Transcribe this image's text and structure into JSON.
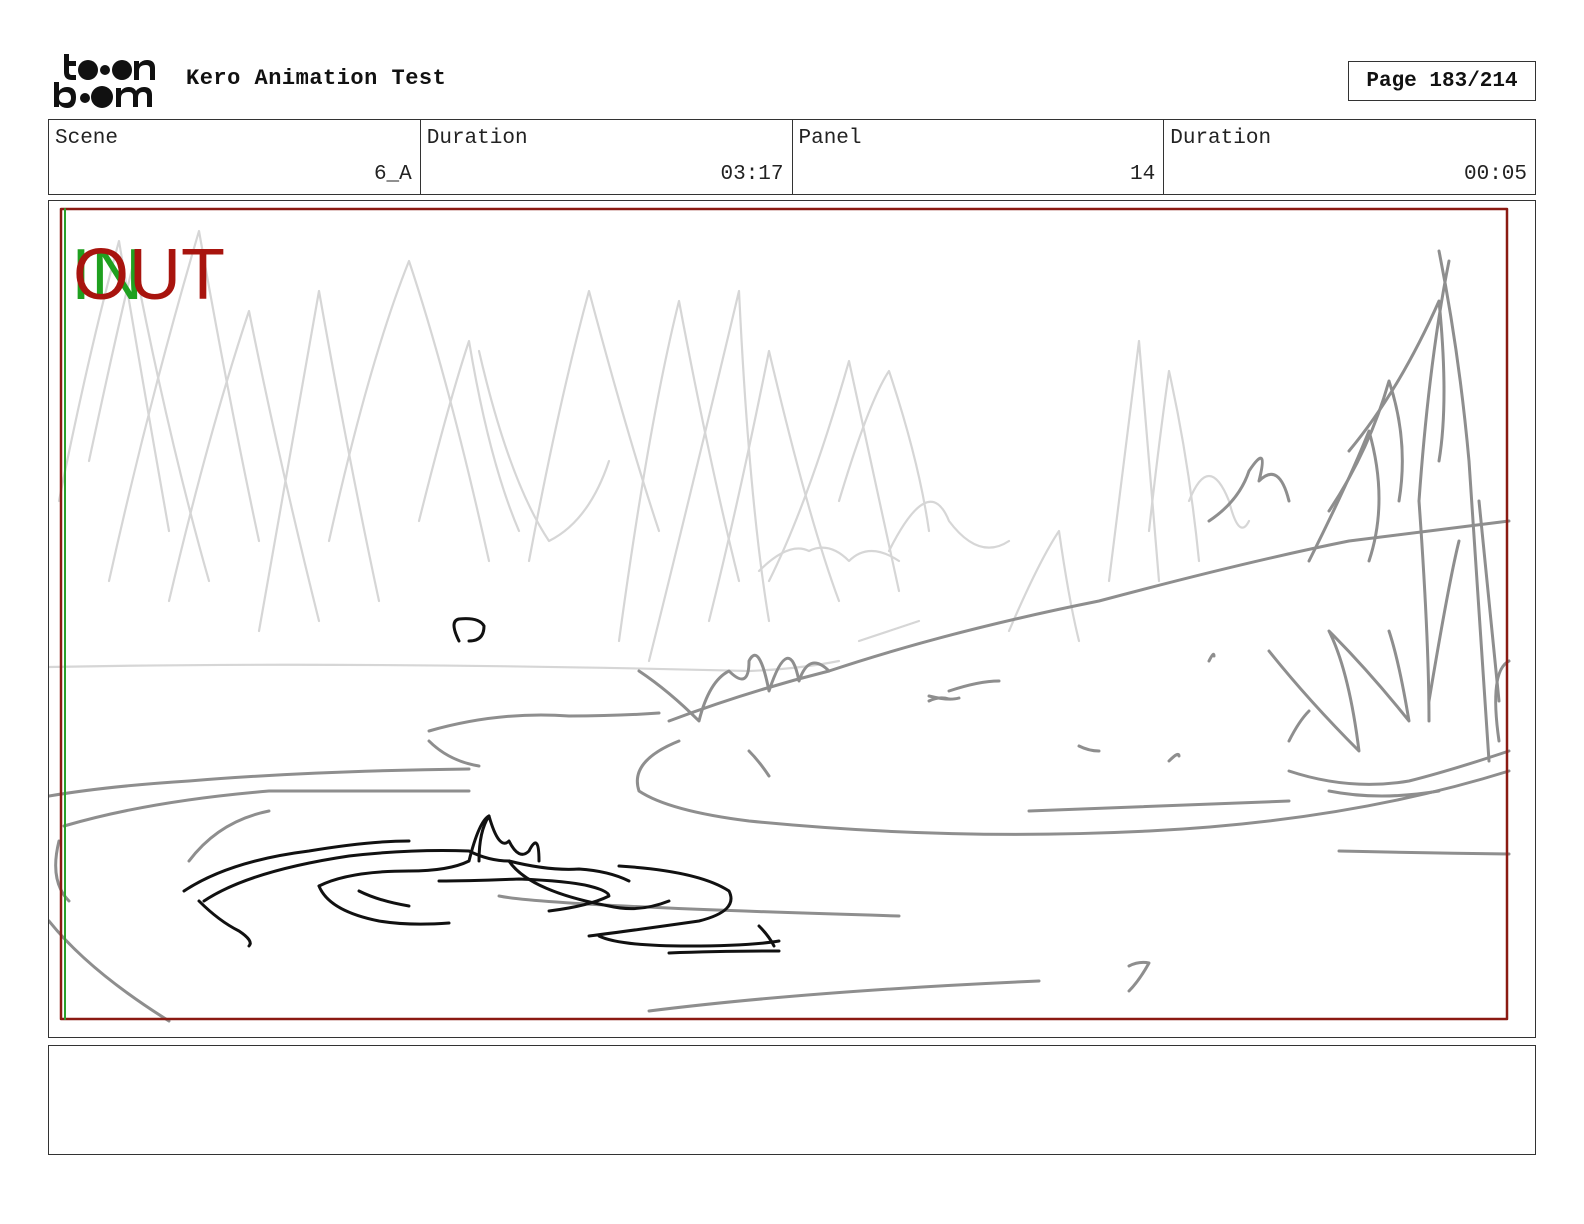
{
  "header": {
    "logo_text": "toon boom",
    "project_title": "Kero Animation Test",
    "page_label": "Page 183/214"
  },
  "info": {
    "scene_label": "Scene",
    "scene_value": "6_A",
    "scene_duration_label": "Duration",
    "scene_duration_value": "03:17",
    "panel_label": "Panel",
    "panel_value": "14",
    "panel_duration_label": "Duration",
    "panel_duration_value": "00:05"
  },
  "panel": {
    "out_label": "OUT",
    "in_label": "IN",
    "out_color": "#a8140e",
    "in_color": "#1fa01f",
    "frame_color": "#8b1a12"
  },
  "notes": {
    "text": ""
  }
}
